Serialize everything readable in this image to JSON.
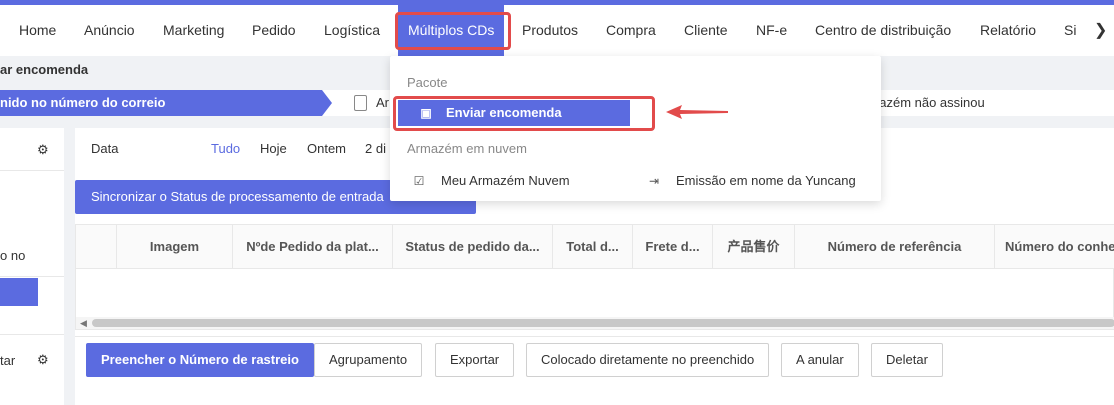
{
  "nav": {
    "items": [
      "Home",
      "Anúncio",
      "Marketing",
      "Pedido",
      "Logística",
      "Múltiplos CDs",
      "Produtos",
      "Compra",
      "Cliente",
      "NF-e",
      "Centro de distribuição",
      "Relatório",
      "Si"
    ],
    "active": "Múltiplos CDs",
    "more": "❯"
  },
  "breadcrumb": "ar encomenda",
  "steps": {
    "step1": "nido no número do correio",
    "step2": "Ar",
    "step_last": "nazém não assinou"
  },
  "left": {
    "label_no": "o no",
    "label_tar": "tar"
  },
  "filter": {
    "label": "Data",
    "options": [
      "Tudo",
      "Hoje",
      "Ontem",
      "2 di"
    ],
    "selected": "Tudo"
  },
  "sync_button": "Sincronizar o Status de processamento de entrada",
  "table": {
    "columns": [
      "Imagem",
      "Nºde Pedido da plat...",
      "Status de pedido da...",
      "Total d...",
      "Frete d...",
      "产品售价",
      "Número de referência",
      "Número do conhe"
    ]
  },
  "actions": {
    "fill_tracking": "Preencher o Número de rastreio",
    "group": "Agrupamento",
    "export": "Exportar",
    "placed_directly": "Colocado diretamente no preenchido",
    "cancel": "A anular",
    "delete": "Deletar"
  },
  "dropdown": {
    "group1": "Pacote",
    "send_package": "Enviar encomenda",
    "group2": "Armazém em nuvem",
    "my_cloud": "Meu Armazém Nuvem",
    "issue_yuncang": "Emissão em nome da Yuncang"
  },
  "colors": {
    "accent": "#5b6be0",
    "highlight": "#e24b4b"
  }
}
